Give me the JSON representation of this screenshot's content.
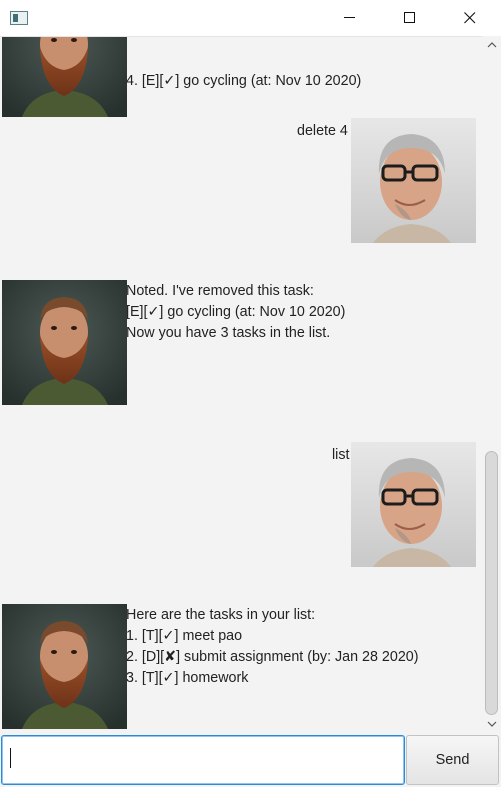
{
  "window": {
    "controls": [
      "minimize",
      "maximize",
      "close"
    ]
  },
  "messages": [
    {
      "sender": "duke",
      "avatar": "bearded-man-avatar",
      "text": "4. [E][✓] go cycling (at: Nov 10 2020)"
    },
    {
      "sender": "user",
      "avatar": "gray-haired-man-avatar",
      "text": "delete 4"
    },
    {
      "sender": "duke",
      "avatar": "bearded-man-avatar",
      "text": "Noted. I've removed this task:\n[E][✓] go cycling (at: Nov 10 2020)\nNow you have 3 tasks in the list."
    },
    {
      "sender": "user",
      "avatar": "gray-haired-man-avatar",
      "text": "list"
    },
    {
      "sender": "duke",
      "avatar": "bearded-man-avatar",
      "text": "Here are the tasks in your list:\n1. [T][✓] meet pao\n2. [D][✘] submit assignment (by: Jan 28 2020)\n3. [T][✓] homework"
    }
  ],
  "input": {
    "value": "",
    "placeholder": ""
  },
  "send_button": {
    "label": "Send"
  },
  "scroll": {
    "position_fraction": 1.0,
    "visible_fraction": 0.4
  },
  "colors": {
    "chat_background": "#f3f3f3",
    "input_focus_border": "#2b8ad6"
  }
}
